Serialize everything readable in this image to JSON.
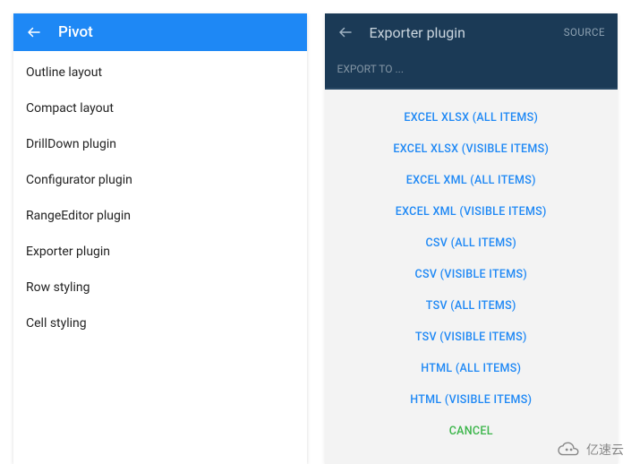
{
  "left": {
    "title": "Pivot",
    "items": [
      "Outline layout",
      "Compact layout",
      "DrillDown plugin",
      "Configurator plugin",
      "RangeEditor plugin",
      "Exporter plugin",
      "Row styling",
      "Cell styling"
    ]
  },
  "right": {
    "title": "Exporter plugin",
    "source_label": "SOURCE",
    "subheader": "EXPORT TO ...",
    "options": [
      "EXCEL XLSX (ALL ITEMS)",
      "EXCEL XLSX (VISIBLE ITEMS)",
      "EXCEL XML (ALL ITEMS)",
      "EXCEL XML (VISIBLE ITEMS)",
      "CSV (ALL ITEMS)",
      "CSV (VISIBLE ITEMS)",
      "TSV (ALL ITEMS)",
      "TSV (VISIBLE ITEMS)",
      "HTML (ALL ITEMS)",
      "HTML (VISIBLE ITEMS)"
    ],
    "cancel": "CANCEL"
  },
  "watermark": "亿速云"
}
